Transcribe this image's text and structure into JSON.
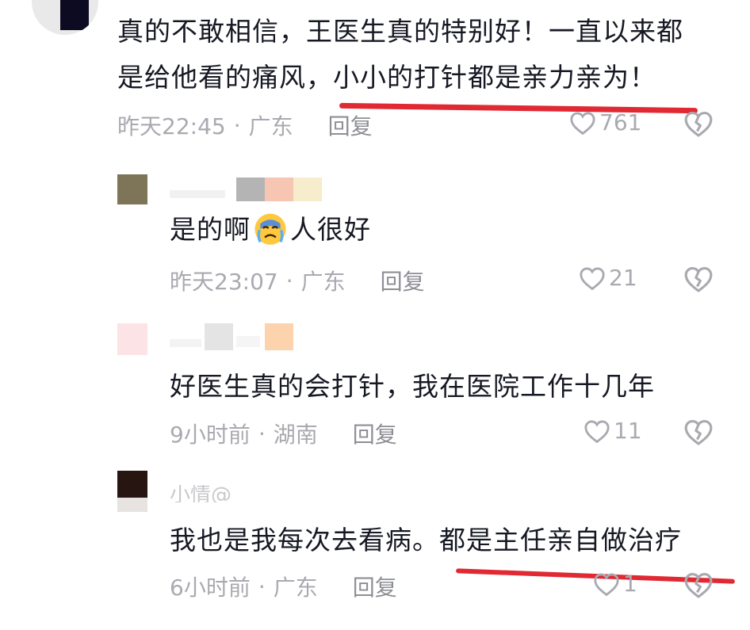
{
  "comments": [
    {
      "text_line1": "真的不敢相信，王医生真的特别好！一直以来都",
      "text_line2": "是给他看的痛风，小小的打针都是亲力亲为！",
      "time": "昨天22:45",
      "location": "广东",
      "reply_label": "回复",
      "likes": "761"
    },
    {
      "text_before_emoji": "是的啊",
      "emoji": "crying-face-emoji",
      "text_after_emoji": "人很好",
      "time": "昨天23:07",
      "location": "广东",
      "reply_label": "回复",
      "likes": "21"
    },
    {
      "text": "好医生真的会打针，我在医院工作十几年",
      "time": "9小时前",
      "location": "湖南",
      "reply_label": "回复",
      "likes": "11"
    },
    {
      "username_fragment": "小情@",
      "text": "我也是我每次去看病。都是主任亲自做治疗",
      "time": "6小时前",
      "location": "广东",
      "reply_label": "回复",
      "likes": "1"
    }
  ],
  "separator": "·",
  "colors": {
    "annotation_red": "#e02933",
    "meta_gray": "#a9aab0",
    "text": "#161823"
  },
  "icons": [
    "heart-outline-icon",
    "broken-heart-icon"
  ]
}
